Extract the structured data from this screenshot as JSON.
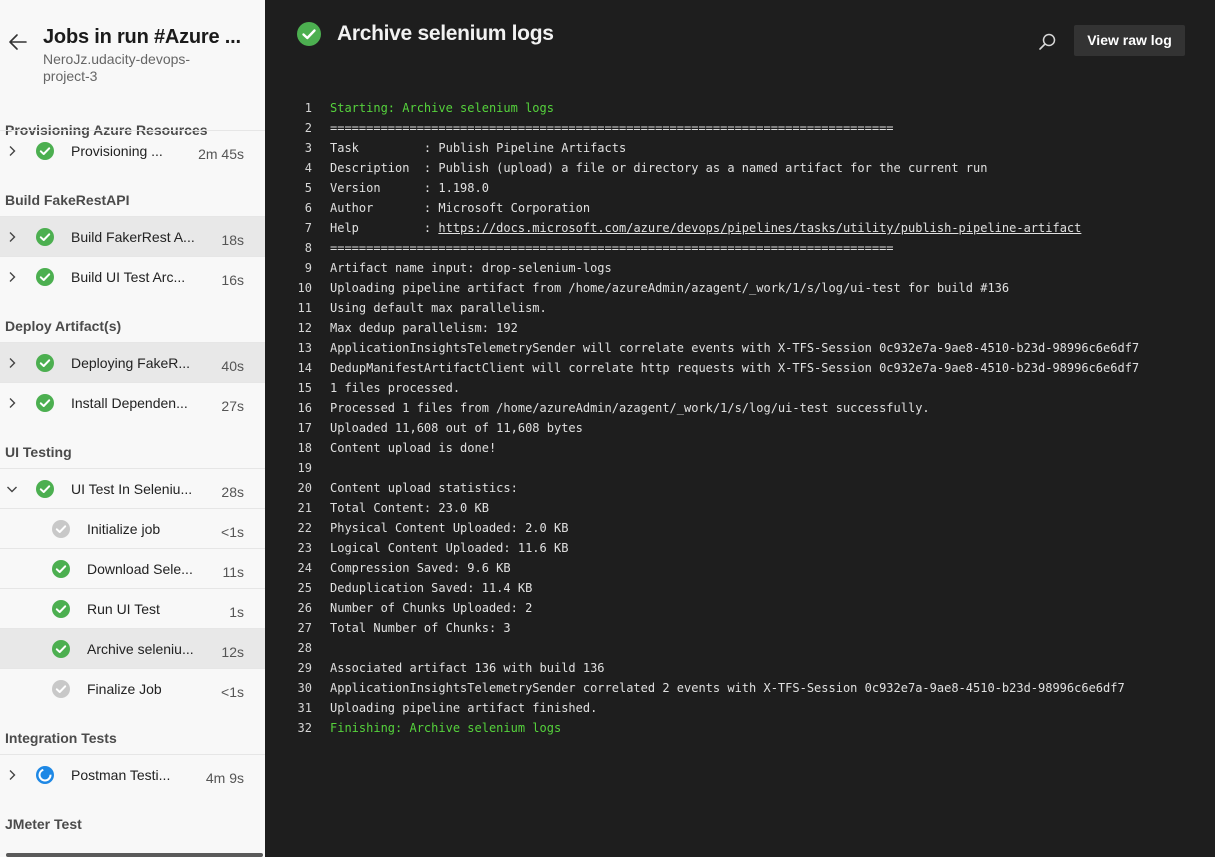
{
  "header": {
    "title": "Jobs in run #Azure ...",
    "subtitle": "NeroJz.udacity-devops-project-3"
  },
  "colors": {
    "success": "#4caf50",
    "skipped": "#bdbdbd",
    "running": "#1e88e5",
    "log_green": "#55d23c"
  },
  "stages": [
    {
      "name": "Provisioning Azure Resources",
      "jobs": [
        {
          "label": "Provisioning ...",
          "duration": "2m 45s",
          "status": "success",
          "expanded": false,
          "selected": false
        }
      ]
    },
    {
      "name": "Build FakeRestAPI",
      "jobs": [
        {
          "label": "Build FakerRest A...",
          "duration": "18s",
          "status": "success",
          "expanded": false,
          "selected": true
        },
        {
          "label": "Build UI Test Arc...",
          "duration": "16s",
          "status": "success",
          "expanded": false,
          "selected": false
        }
      ]
    },
    {
      "name": "Deploy Artifact(s)",
      "jobs": [
        {
          "label": "Deploying FakeR...",
          "duration": "40s",
          "status": "success",
          "expanded": false,
          "selected": true
        },
        {
          "label": "Install Dependen...",
          "duration": "27s",
          "status": "success",
          "expanded": false,
          "selected": false
        }
      ]
    },
    {
      "name": "UI Testing",
      "jobs": [
        {
          "label": "UI Test In Seleniu...",
          "duration": "28s",
          "status": "success",
          "expanded": true,
          "selected": false,
          "steps": [
            {
              "label": "Initialize job",
              "duration": "<1s",
              "status": "skipped",
              "selected": false
            },
            {
              "label": "Download Sele...",
              "duration": "11s",
              "status": "success",
              "selected": false
            },
            {
              "label": "Run UI Test",
              "duration": "1s",
              "status": "success",
              "selected": false
            },
            {
              "label": "Archive seleniu...",
              "duration": "12s",
              "status": "success",
              "selected": true
            },
            {
              "label": "Finalize Job",
              "duration": "<1s",
              "status": "skipped",
              "selected": false
            }
          ]
        }
      ]
    },
    {
      "name": "Integration Tests",
      "jobs": [
        {
          "label": "Postman Testi...",
          "duration": "4m 9s",
          "status": "running",
          "expanded": false,
          "selected": false
        }
      ]
    },
    {
      "name": "JMeter Test",
      "jobs": []
    }
  ],
  "main": {
    "title": "Archive selenium logs",
    "status": "success",
    "view_raw_label": "View raw log",
    "search_icon": "search-icon"
  },
  "log_lines": [
    {
      "n": "1",
      "text": "Starting: Archive selenium logs",
      "green": true
    },
    {
      "n": "2",
      "text": "=============================================================================="
    },
    {
      "n": "3",
      "text": "Task         : Publish Pipeline Artifacts"
    },
    {
      "n": "4",
      "text": "Description  : Publish (upload) a file or directory as a named artifact for the current run"
    },
    {
      "n": "5",
      "text": "Version      : 1.198.0"
    },
    {
      "n": "6",
      "text": "Author       : Microsoft Corporation"
    },
    {
      "n": "7",
      "text": "Help         : ",
      "link": "https://docs.microsoft.com/azure/devops/pipelines/tasks/utility/publish-pipeline-artifact"
    },
    {
      "n": "8",
      "text": "=============================================================================="
    },
    {
      "n": "9",
      "text": "Artifact name input: drop-selenium-logs"
    },
    {
      "n": "10",
      "text": "Uploading pipeline artifact from /home/azureAdmin/azagent/_work/1/s/log/ui-test for build #136"
    },
    {
      "n": "11",
      "text": "Using default max parallelism."
    },
    {
      "n": "12",
      "text": "Max dedup parallelism: 192"
    },
    {
      "n": "13",
      "text": "ApplicationInsightsTelemetrySender will correlate events with X-TFS-Session 0c932e7a-9ae8-4510-b23d-98996c6e6df7"
    },
    {
      "n": "14",
      "text": "DedupManifestArtifactClient will correlate http requests with X-TFS-Session 0c932e7a-9ae8-4510-b23d-98996c6e6df7"
    },
    {
      "n": "15",
      "text": "1 files processed."
    },
    {
      "n": "16",
      "text": "Processed 1 files from /home/azureAdmin/azagent/_work/1/s/log/ui-test successfully."
    },
    {
      "n": "17",
      "text": "Uploaded 11,608 out of 11,608 bytes"
    },
    {
      "n": "18",
      "text": "Content upload is done!"
    },
    {
      "n": "19",
      "text": ""
    },
    {
      "n": "20",
      "text": "Content upload statistics:"
    },
    {
      "n": "21",
      "text": "Total Content: 23.0 KB"
    },
    {
      "n": "22",
      "text": "Physical Content Uploaded: 2.0 KB"
    },
    {
      "n": "23",
      "text": "Logical Content Uploaded: 11.6 KB"
    },
    {
      "n": "24",
      "text": "Compression Saved: 9.6 KB"
    },
    {
      "n": "25",
      "text": "Deduplication Saved: 11.4 KB"
    },
    {
      "n": "26",
      "text": "Number of Chunks Uploaded: 2"
    },
    {
      "n": "27",
      "text": "Total Number of Chunks: 3"
    },
    {
      "n": "28",
      "text": ""
    },
    {
      "n": "29",
      "text": "Associated artifact 136 with build 136"
    },
    {
      "n": "30",
      "text": "ApplicationInsightsTelemetrySender correlated 2 events with X-TFS-Session 0c932e7a-9ae8-4510-b23d-98996c6e6df7"
    },
    {
      "n": "31",
      "text": "Uploading pipeline artifact finished."
    },
    {
      "n": "32",
      "text": "Finishing: Archive selenium logs",
      "green": true
    }
  ]
}
